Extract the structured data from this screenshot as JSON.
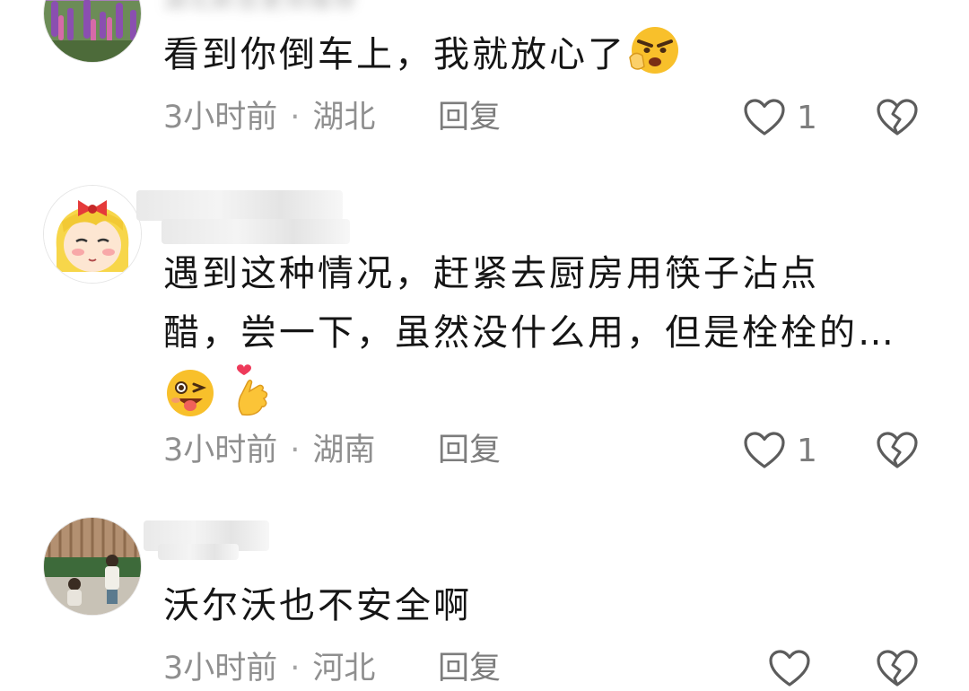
{
  "comments": [
    {
      "username": "湖北新吾更郑推荐",
      "text": "看到你倒车上，我就放心了",
      "emojis": [
        "angry-finger-emoji"
      ],
      "time": "3小时前",
      "separator": "·",
      "location": "湖北",
      "reply_label": "回复",
      "likes": "1"
    },
    {
      "username": "",
      "text_lines": [
        "遇到这种情况，赶紧去厨房用筷子沾点",
        "醋，尝一下，虽然没什么用，但是栓栓的…"
      ],
      "emojis": [
        "wink-tongue-emoji",
        "finger-heart-emoji"
      ],
      "time": "3小时前",
      "separator": "·",
      "location": "湖南",
      "reply_label": "回复",
      "likes": "1"
    },
    {
      "username": "",
      "text": "沃尔沃也不安全啊",
      "time": "3小时前",
      "separator": "·",
      "location": "河北",
      "reply_label": "回复",
      "likes": ""
    }
  ],
  "icons": {
    "like": "heart-outline-icon",
    "dislike": "broken-heart-icon"
  },
  "colors": {
    "text": "#151515",
    "meta": "#8f8f8f",
    "icon": "#5c5c5c"
  }
}
